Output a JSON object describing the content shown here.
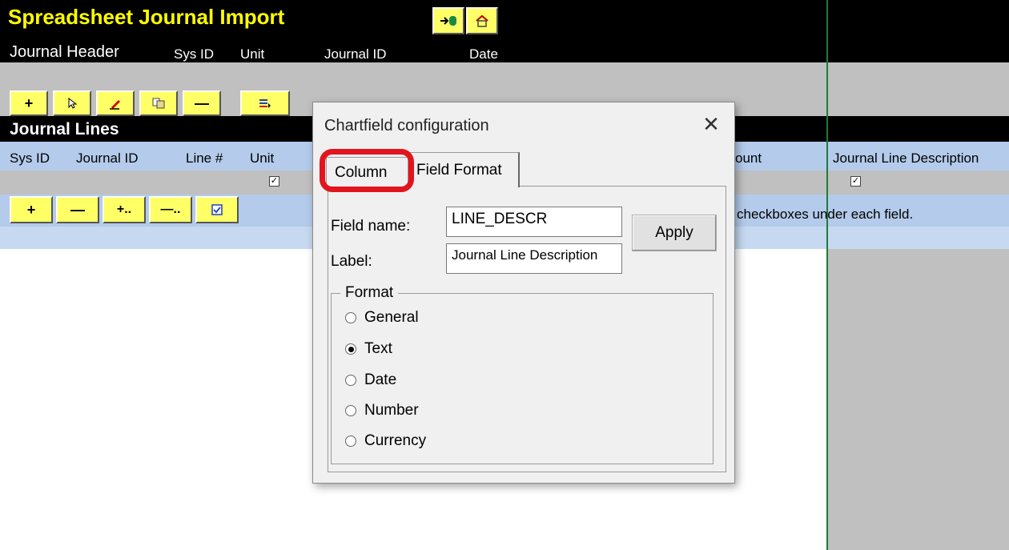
{
  "app": {
    "title": "Spreadsheet Journal Import"
  },
  "header": {
    "section_label": "Journal Header",
    "sys_id": "Sys ID",
    "unit": "Unit",
    "journal_id": "Journal ID",
    "date": "Date"
  },
  "lines": {
    "section_label": "Journal Lines",
    "columns": {
      "sys_id": "Sys ID",
      "journal_id": "Journal ID",
      "line_no": "Line #",
      "unit": "Unit",
      "amount_partial": "ount",
      "description": "Journal Line Description"
    },
    "note_partial": "checkboxes under each field."
  },
  "dialog": {
    "title": "Chartfield configuration",
    "close_glyph": "✕",
    "tabs": [
      {
        "label": "Column",
        "selected": false,
        "highlighted": true
      },
      {
        "label": "Field Format",
        "selected": true
      }
    ],
    "field_name_label": "Field name:",
    "field_name_value": "LINE_DESCR",
    "label_label": "Label:",
    "label_value": "Journal Line Description",
    "apply_label": "Apply",
    "format_group_label": "Format",
    "format_options": [
      {
        "label": "General",
        "selected": false
      },
      {
        "label": "Text",
        "selected": true
      },
      {
        "label": "Date",
        "selected": false
      },
      {
        "label": "Number",
        "selected": false
      },
      {
        "label": "Currency",
        "selected": false
      }
    ]
  },
  "colors": {
    "title_yellow": "#ffff00",
    "button_yellow": "#ffff66",
    "band_grey": "#c0c0c0",
    "row_blue": "#b4cbeb",
    "highlight_red": "#e2141e",
    "divider_green": "#1f7a3a"
  },
  "icons": {
    "top_buttons": [
      "import-arrow-icon",
      "home-icon"
    ],
    "header_toolbar": [
      "add-icon",
      "select-cursor-icon",
      "edit-pencil-icon",
      "copy-icon",
      "remove-icon",
      "insert-rows-icon"
    ],
    "lines_toolbar": [
      "add-icon",
      "remove-icon",
      "add-many-icon",
      "remove-many-icon",
      "checkbox-toggle-icon"
    ]
  }
}
